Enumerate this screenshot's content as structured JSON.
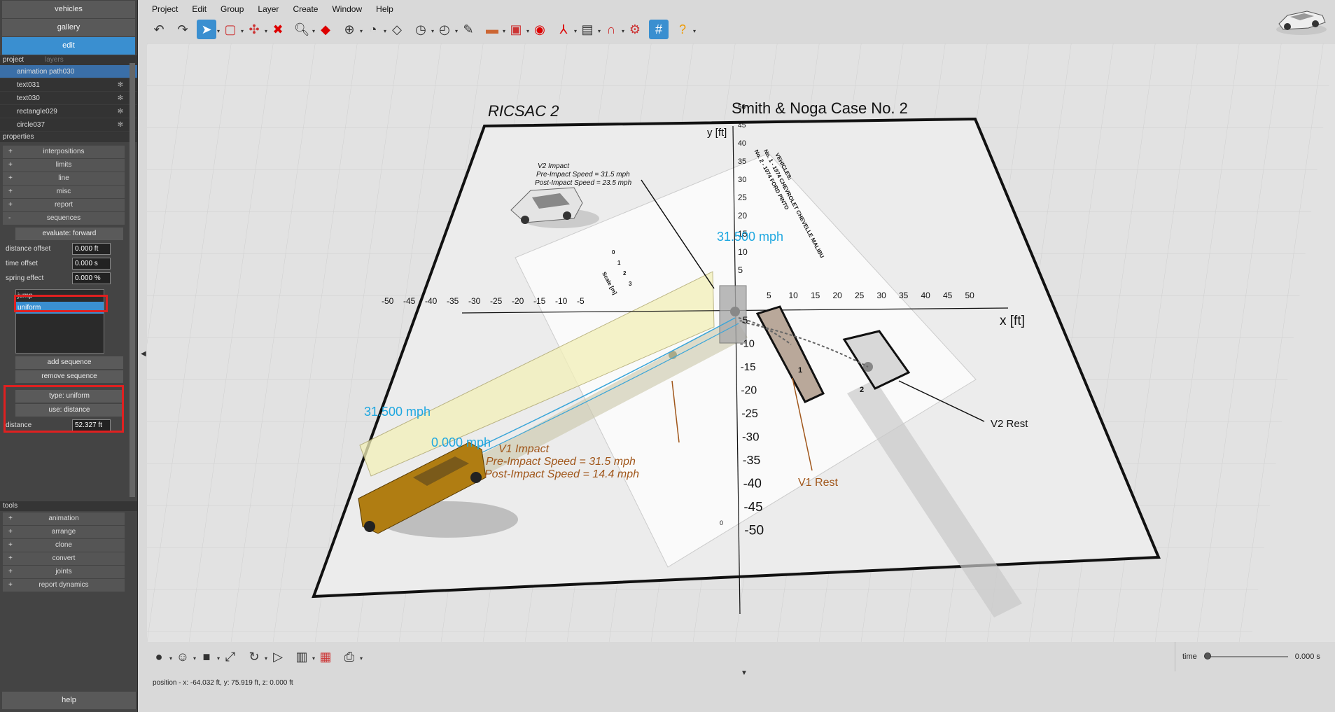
{
  "left_panel": {
    "top_buttons": [
      "vehicles",
      "gallery",
      "edit"
    ],
    "project_tab": "project",
    "layers_tab": "layers",
    "project_items": [
      "animation path030",
      "text031",
      "text030",
      "rectangle029",
      "circle037"
    ],
    "properties_header": "properties",
    "prop_groups": [
      "interpositions",
      "limits",
      "line",
      "misc",
      "report",
      "sequences"
    ],
    "evaluate_button": "evaluate: forward",
    "fields": [
      {
        "label": "distance offset",
        "value": "0.000 ft"
      },
      {
        "label": "time offset",
        "value": "0.000 s"
      },
      {
        "label": "spring effect",
        "value": "0.000 %"
      }
    ],
    "sequence_list": [
      "jump",
      "uniform"
    ],
    "add_sequence": "add sequence",
    "remove_sequence": "remove sequence",
    "type_label": "type: uniform",
    "use_label": "use: distance",
    "distance_label": "distance",
    "distance_value": "52.327 ft",
    "tools_header": "tools",
    "tool_groups": [
      "animation",
      "arrange",
      "clone",
      "convert",
      "joints",
      "report dynamics"
    ],
    "help": "help"
  },
  "menu": [
    "Project",
    "Edit",
    "Group",
    "Layer",
    "Create",
    "Window",
    "Help"
  ],
  "toolbar_icons": [
    "undo-icon",
    "redo-icon",
    "select-arrow-icon",
    "rect-select-icon",
    "pin-icon",
    "delete-x-icon",
    "zoom-icon",
    "cube-icon",
    "target-icon",
    "measure-icon",
    "grid-icon",
    "speed-icon",
    "timer-icon",
    "light-icon",
    "knife-icon",
    "camera-icon",
    "record-icon",
    "axes-icon",
    "layers-icon",
    "magnet-icon",
    "gear-icon",
    "grid-snap-icon",
    "help-icon"
  ],
  "scene": {
    "title_left": "RICSAC 2",
    "title_right": "Smith & Noga Case No. 2",
    "y_axis_label": "y [ft]",
    "x_axis_label": "x [ft]",
    "x_ticks_neg": [
      "-50",
      "-45",
      "-40",
      "-35",
      "-30",
      "-25",
      "-20",
      "-15",
      "-10",
      "-5"
    ],
    "x_ticks_pos": [
      "5",
      "10",
      "15",
      "20",
      "25",
      "30",
      "35",
      "40",
      "45",
      "50"
    ],
    "y_ticks_pos": [
      "50",
      "45",
      "40",
      "35",
      "30",
      "25",
      "20",
      "15",
      "10",
      "5"
    ],
    "y_ticks_neg": [
      "-5",
      "-10",
      "-15",
      "-20",
      "-25",
      "-30",
      "-35",
      "-40",
      "-45",
      "-50"
    ],
    "speed_top": "31.500 mph",
    "speed_left": "31.500 mph",
    "speed_zero": "0.000 mph",
    "v2_impact": [
      "V2 Impact",
      "Pre-Impact Speed = 31.5 mph",
      "Post-Impact Speed = 23.5 mph"
    ],
    "v1_impact": [
      "V1 Impact",
      "Pre-Impact Speed = 31.5 mph",
      "Post-Impact Speed = 14.4 mph"
    ],
    "v1_rest": "V1 Rest",
    "v2_rest": "V2 Rest",
    "vehicles_note": [
      "VEHICLES:",
      "No. 1 - 1974 CHEVROLET CHEVELLE MALIBU",
      "No. 2 - 1974 FORD PINTO"
    ],
    "scale_label": "Scale [m]",
    "scale_ticks": [
      "0",
      "1",
      "2",
      "3"
    ],
    "zero_mark": "0",
    "veh_num1": "1",
    "veh_num2": "2"
  },
  "status": "position - x: -64.032 ft, y: 75.919 ft, z: 0.000 ft",
  "time_label": "time",
  "time_value": "0.000 s",
  "bottom_icons": [
    "sphere-icon",
    "head-icon",
    "color-swatch-icon",
    "curve-icon",
    "rotate-icon",
    "play-icon",
    "export-icon",
    "report-icon",
    "print-icon"
  ]
}
